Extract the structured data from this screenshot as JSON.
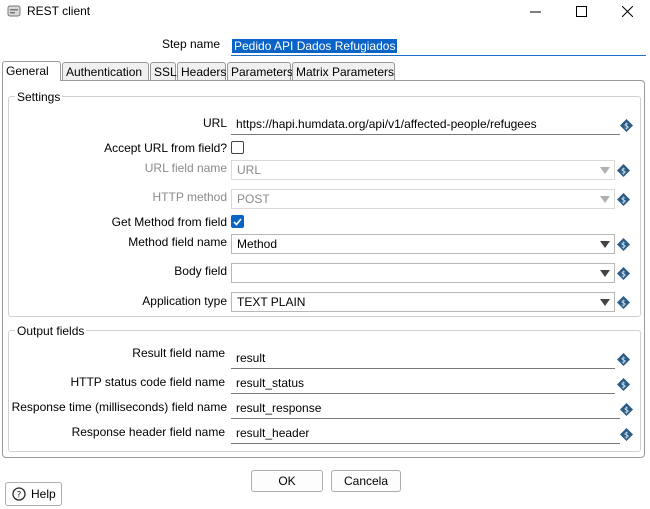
{
  "window": {
    "title": "REST client",
    "minimize_icon": "minimize-icon",
    "maximize_icon": "maximize-icon",
    "close_icon": "close-icon"
  },
  "step_name": {
    "label": "Step name",
    "value": "Pedido API Dados Refugiados"
  },
  "tabs": [
    {
      "label": "General"
    },
    {
      "label": "Authentication"
    },
    {
      "label": "SSL"
    },
    {
      "label": "Headers"
    },
    {
      "label": "Parameters"
    },
    {
      "label": "Matrix Parameters"
    }
  ],
  "settings": {
    "title": "Settings",
    "url": {
      "label": "URL",
      "value": "https://hapi.humdata.org/api/v1/affected-people/refugees"
    },
    "accept_url_from_field": {
      "label": "Accept URL from field?",
      "checked": false
    },
    "url_field_name": {
      "label": "URL field name",
      "value": "URL"
    },
    "http_method": {
      "label": "HTTP method",
      "value": "POST"
    },
    "get_method_from_field": {
      "label": "Get Method from field",
      "checked": true
    },
    "method_field_name": {
      "label": "Method field name",
      "value": "Method"
    },
    "body_field": {
      "label": "Body field",
      "value": ""
    },
    "application_type": {
      "label": "Application type",
      "value": "TEXT PLAIN"
    }
  },
  "output_fields": {
    "title": "Output fields",
    "result_field_name": {
      "label": "Result field name",
      "value": "result"
    },
    "http_status_code_field_name": {
      "label": "HTTP status code field name",
      "value": "result_status"
    },
    "response_time_field_name": {
      "label": "Response time (milliseconds) field name",
      "value": "result_response"
    },
    "response_header_field_name": {
      "label": "Response header field name",
      "value": "result_header"
    }
  },
  "buttons": {
    "ok": "OK",
    "cancel": "Cancela",
    "help": "Help"
  },
  "colors": {
    "accent": "#0a64c8",
    "variable_icon": "#2a5d86"
  }
}
